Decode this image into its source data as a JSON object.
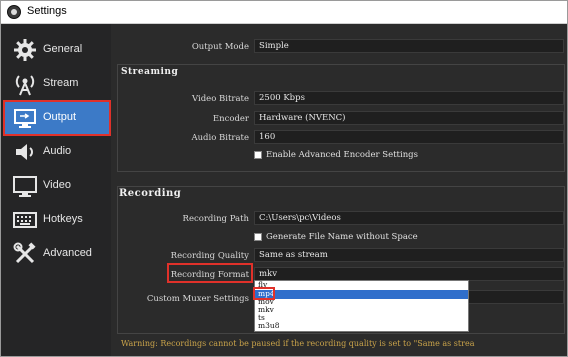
{
  "window": {
    "title": "Settings"
  },
  "sidebar": {
    "items": [
      {
        "label": "General",
        "icon": "gear-icon"
      },
      {
        "label": "Stream",
        "icon": "broadcast-antenna-icon"
      },
      {
        "label": "Output",
        "icon": "monitor-output-icon",
        "active": true
      },
      {
        "label": "Audio",
        "icon": "speaker-icon"
      },
      {
        "label": "Video",
        "icon": "display-icon"
      },
      {
        "label": "Hotkeys",
        "icon": "keyboard-icon"
      },
      {
        "label": "Advanced",
        "icon": "wrench-screwdriver-icon"
      }
    ]
  },
  "output_mode": {
    "label": "Output Mode",
    "value": "Simple"
  },
  "streaming": {
    "title": "Streaming",
    "video_bitrate": {
      "label": "Video Bitrate",
      "value": "2500 Kbps"
    },
    "encoder": {
      "label": "Encoder",
      "value": "Hardware (NVENC)"
    },
    "audio_bitrate": {
      "label": "Audio Bitrate",
      "value": "160"
    },
    "advanced_encoder": {
      "label": "Enable Advanced Encoder Settings",
      "checked": false
    }
  },
  "recording": {
    "title": "Recording",
    "path": {
      "label": "Recording Path",
      "value": "C:\\Users\\pc\\Videos"
    },
    "no_space": {
      "label": "Generate File Name without Space",
      "checked": false
    },
    "quality": {
      "label": "Recording Quality",
      "value": "Same as stream"
    },
    "format": {
      "label": "Recording Format",
      "value": "mkv"
    },
    "muxer": {
      "label": "Custom Muxer Settings"
    },
    "format_options": [
      "flv",
      "mp4",
      "mov",
      "mkv",
      "ts",
      "m3u8"
    ],
    "selected_option": "mp4"
  },
  "warning": "Warning: Recordings cannot be paused if the recording quality is set to \"Same as strea",
  "colors": {
    "accent": "#3c7ac7",
    "highlight_red": "#e0312a",
    "warning": "#c9a34a",
    "selection": "#2f6ecb"
  }
}
